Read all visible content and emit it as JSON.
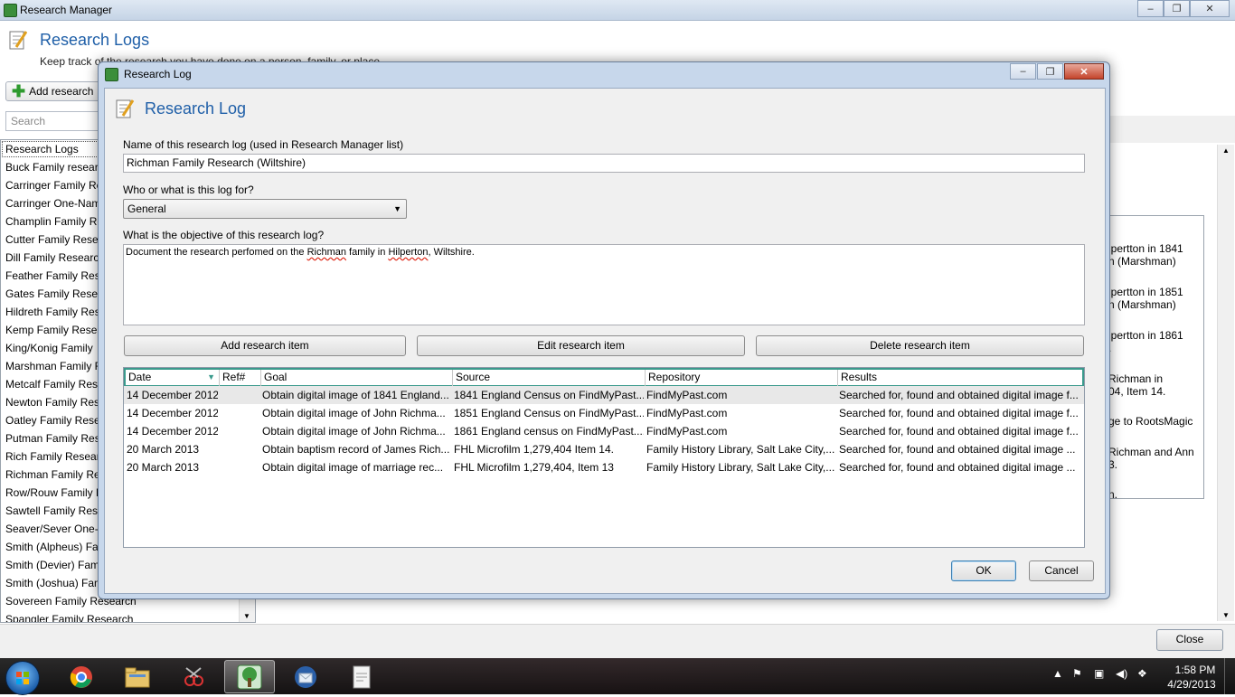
{
  "manager": {
    "window_title": "Research Manager",
    "caption": {
      "minimize": "–",
      "maximize": "❐",
      "close": "✕"
    },
    "header_title": "Research Logs",
    "header_subtitle": "Keep track of the research you have done on a person, family, or place.",
    "add_button": "Add research",
    "search_placeholder": "Search",
    "list_header": "Research Logs",
    "list_items": [
      "Buck Family research",
      "Carringer Family Re",
      "Carringer One-Nam",
      "Champlin Family Re",
      "Cutter Family Resea",
      "Dill Family Research",
      "Feather Family Rese",
      "Gates Family Resear",
      "Hildreth Family Res",
      "Kemp Family Resea",
      "King/Konig Family",
      "Marshman Family R",
      "Metcalf Family Rese",
      "Newton Family Res",
      "Oatley Family Resea",
      "Putman Family Res",
      "Rich Family Researc",
      "Richman Family Re",
      "Row/Rouw Family F",
      "Sawtell Family Rese",
      "Seaver/Sever One-N",
      "Smith (Alpheus) Fa",
      "Smith (Devier) Fam",
      "Smith (Joshua) Fam",
      "Sovereen Family Research",
      "Spangler Family Research"
    ],
    "right_pane_lines": [
      "lpertton in 1841",
      "n (Marshman)",
      "lpertton in 1851",
      "n (Marshman)",
      "lpertton in 1861",
      ".",
      "Richman in",
      "04, Item 14.",
      "ge to RootsMagic",
      "Richman and Ann",
      "3.",
      "n."
    ],
    "close_button": "Close"
  },
  "dialog": {
    "window_title": "Research Log",
    "header_title": "Research Log",
    "name_label": "Name of this research log (used in Research Manager list)",
    "name_value": "Richman Family Research (Wiltshire)",
    "for_label": "Who or what is this log for?",
    "for_value": "General",
    "objective_label": "What is the objective of this research log?",
    "objective_parts": [
      "Document the research perfomed on the ",
      "Richman",
      " family in ",
      "Hilperton",
      ", Wiltshire."
    ],
    "add_item": "Add research item",
    "edit_item": "Edit research item",
    "delete_item": "Delete research item",
    "columns": [
      "Date",
      "Ref#",
      "Goal",
      "Source",
      "Repository",
      "Results"
    ],
    "rows": [
      [
        "14 December 2012",
        "",
        "Obtain digital image of 1841 England...",
        "1841 England Census on FindMyPast....",
        "FindMyPast.com",
        "Searched for, found and obtained digital image f..."
      ],
      [
        "14 December 2012",
        "",
        "Obtain digital image of John Richma...",
        "1851 England Census on FindMyPast....",
        "FindMyPast.com",
        "Searched for, found and obtained digital image f..."
      ],
      [
        "14 December 2012",
        "",
        "Obtain digital image of John Richma...",
        "1861 England census on FindMyPast....",
        "FindMyPast.com",
        "Searched for, found and obtained digital image f..."
      ],
      [
        "20 March 2013",
        "",
        "Obtain baptism record of James Rich...",
        "FHL Microfilm 1,279,404 Item 14.",
        "Family History Library, Salt Lake City,...",
        "Searched for, found and obtained digital image ..."
      ],
      [
        "20 March 2013",
        "",
        "Obtain digital image of marriage rec...",
        "FHL Microfilm 1,279,404, Item 13",
        "Family History Library, Salt Lake City,...",
        "Searched for, found and obtained digital image ..."
      ]
    ],
    "ok": "OK",
    "cancel": "Cancel"
  },
  "taskbar": {
    "time": "1:58 PM",
    "date": "4/29/2013",
    "apps": [
      "chrome-icon",
      "explorer-icon",
      "snipping-tool-icon",
      "rootsmagic-icon",
      "thunderbird-icon",
      "odf-document-icon"
    ]
  }
}
